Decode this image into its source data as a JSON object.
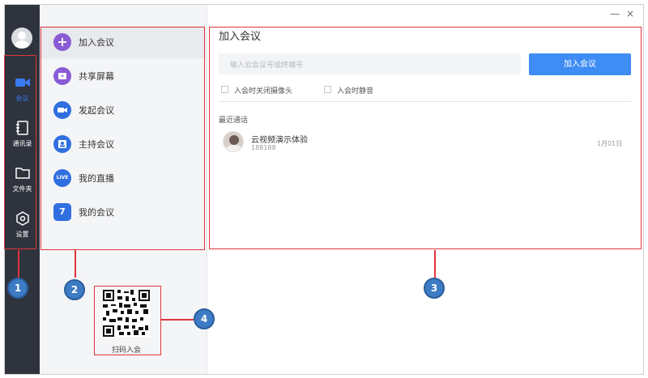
{
  "rail": {
    "items": [
      {
        "label": "会议",
        "icon": "video-camera-icon",
        "active": true
      },
      {
        "label": "通讯录",
        "icon": "contacts-icon",
        "active": false
      },
      {
        "label": "文件夹",
        "icon": "folder-icon",
        "active": false
      },
      {
        "label": "设置",
        "icon": "settings-icon",
        "active": false
      }
    ]
  },
  "nav": {
    "items": [
      {
        "label": "加入会议",
        "icon": "plus-icon",
        "color": "#8a5bd6",
        "glyph": "+"
      },
      {
        "label": "共享屏幕",
        "icon": "share-screen-icon",
        "color": "#8a5bd6",
        "glyph": ""
      },
      {
        "label": "发起会议",
        "icon": "video-camera-icon",
        "color": "#2f6fe0",
        "glyph": ""
      },
      {
        "label": "主持会议",
        "icon": "host-meeting-icon",
        "color": "#2f6fe0",
        "glyph": ""
      },
      {
        "label": "我的直播",
        "icon": "live-icon",
        "color": "#2f6fe0",
        "glyph": "LIVE"
      },
      {
        "label": "我的会议",
        "icon": "calendar-icon",
        "color": "#2f6fe0",
        "glyph": "7"
      }
    ],
    "qr_label": "扫码入会"
  },
  "main": {
    "title": "加入会议",
    "search_placeholder": "输入云会议号或终端号",
    "join_button": "加入会议",
    "checkbox_camera": "入会时关闭摄像头",
    "checkbox_mute": "入会时静音",
    "recent_label": "最近通话",
    "recent": [
      {
        "name": "云视频演示体验",
        "id": "188188",
        "date": "1月01日"
      }
    ]
  },
  "window_controls": {
    "minimize": "—",
    "close": "×"
  },
  "annotations": [
    "1",
    "2",
    "3",
    "4"
  ],
  "colors": {
    "accent": "#3e8cf4",
    "rail_bg": "#2e333d",
    "annotation_red": "#e0363d",
    "badge_blue": "#3d7bc4"
  }
}
